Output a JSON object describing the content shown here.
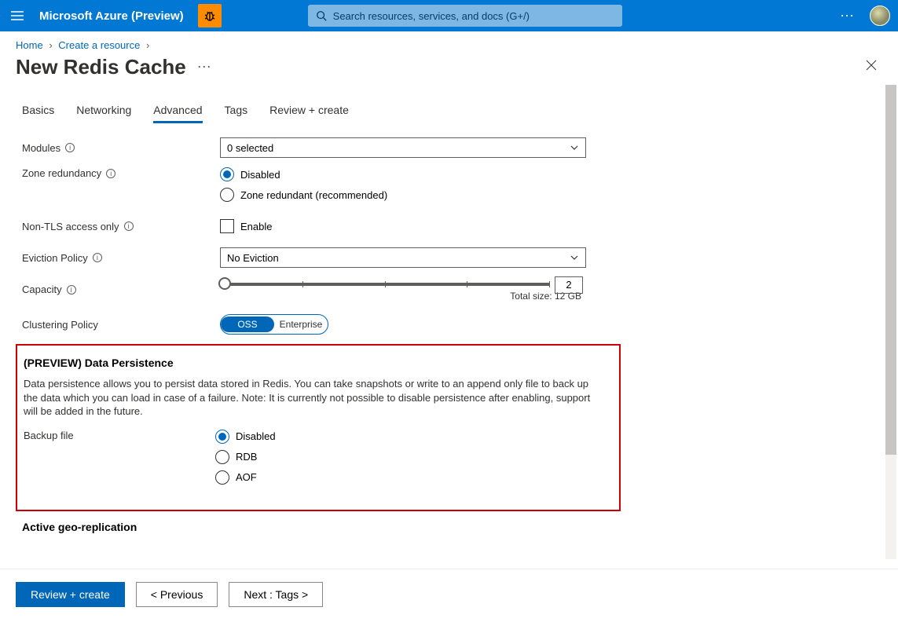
{
  "topbar": {
    "brand": "Microsoft Azure (Preview)",
    "search_placeholder": "Search resources, services, and docs (G+/)"
  },
  "breadcrumb": {
    "items": [
      "Home",
      "Create a resource"
    ]
  },
  "page": {
    "title": "New Redis Cache"
  },
  "tabs": [
    "Basics",
    "Networking",
    "Advanced",
    "Tags",
    "Review + create"
  ],
  "form": {
    "modules_label": "Modules",
    "modules_value": "0 selected",
    "zone_label": "Zone redundancy",
    "zone_options": [
      "Disabled",
      "Zone redundant (recommended)"
    ],
    "nontls_label": "Non-TLS access only",
    "nontls_option": "Enable",
    "eviction_label": "Eviction Policy",
    "eviction_value": "No Eviction",
    "capacity_label": "Capacity",
    "capacity_value": "2",
    "capacity_caption": "Total size: 12 GB",
    "clustering_label": "Clustering Policy",
    "clustering_options": [
      "OSS",
      "Enterprise"
    ]
  },
  "persistence": {
    "heading": "(PREVIEW) Data Persistence",
    "description": "Data persistence allows you to persist data stored in Redis. You can take snapshots or write to an append only file to back up the data which you can load in case of a failure. Note: It is currently not possible to disable persistence after enabling, support will be added in the future.",
    "backup_label": "Backup file",
    "backup_options": [
      "Disabled",
      "RDB",
      "AOF"
    ]
  },
  "geo": {
    "heading": "Active geo-replication"
  },
  "footer": {
    "review": "Review + create",
    "previous": "<  Previous",
    "next": "Next : Tags  >"
  }
}
